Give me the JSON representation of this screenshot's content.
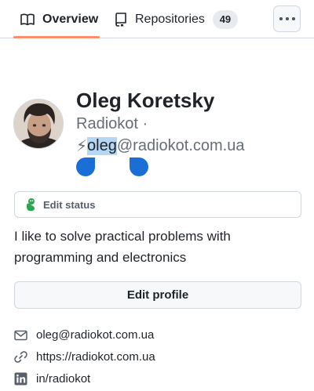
{
  "nav": {
    "tabs": [
      {
        "label": "Overview",
        "icon": "book-icon",
        "active": true
      },
      {
        "label": "Repositories",
        "icon": "repo-icon",
        "count": "49"
      }
    ],
    "more_icon": "kebab-horizontal-icon",
    "accent_color": "#fd8c73"
  },
  "profile": {
    "name": "Oleg Koretsky",
    "nickname_line": "Radiokot ·",
    "email_emoji": "⚡",
    "email_selected": "oleg",
    "email_rest": "@radiokot.com.ua",
    "selection_color": "#1a6fd6"
  },
  "status": {
    "label": "Edit status",
    "icon": "smiley-icon"
  },
  "bio": "I like to solve practical problems with programming and electronics",
  "edit_profile_label": "Edit profile",
  "links": [
    {
      "icon": "mail-icon",
      "text": "oleg@radiokot.com.ua"
    },
    {
      "icon": "link-icon",
      "text": "https://radiokot.com.ua"
    },
    {
      "icon": "linkedin-icon",
      "text": "in/radiokot"
    }
  ]
}
